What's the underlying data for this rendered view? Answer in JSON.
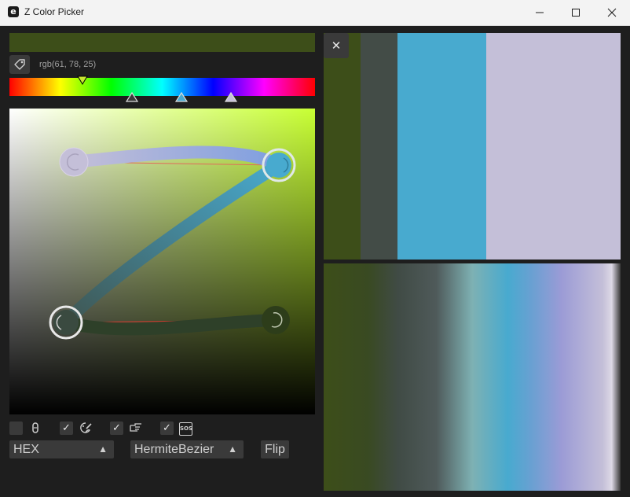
{
  "window": {
    "title": "Z Color Picker",
    "app_icon_letter": "e",
    "controls": [
      "minimize",
      "maximize",
      "close"
    ]
  },
  "current_color": {
    "hex": "#3d4e19",
    "rgb_text": "rgb(61, 78, 25)"
  },
  "hue_bar": {
    "selected_hue_marker_color": "#c8e632",
    "stop_markers": [
      "#3a3a3a",
      "#48aacf",
      "#c4bfd8"
    ]
  },
  "picker_pad": {
    "base_hue": "#c8ff33",
    "curve_colors": [
      "#c4bfd8",
      "#48aacf",
      "#3d4e19"
    ]
  },
  "checkboxes": [
    {
      "icon": "finger-tap-icon",
      "checked": false
    },
    {
      "icon": "palette-brush-icon",
      "checked": true
    },
    {
      "icon": "hand-pointing-icon",
      "checked": true
    },
    {
      "icon": "sos-icon",
      "checked": true
    }
  ],
  "checkbox_check_mark": "✓",
  "combos": {
    "format": {
      "value": "HEX",
      "arrow": "▲"
    },
    "interpolation": {
      "value": "HermiteBezier",
      "arrow": "▲"
    }
  },
  "flip_label": "Flip",
  "close_mark": "✕",
  "palette_colors": [
    "#3d4e19",
    "#434c47",
    "#48aacf",
    "#c4bfd8"
  ],
  "gradient_preview": {
    "from": "#3d4e19",
    "to": "#c4bfd8"
  }
}
